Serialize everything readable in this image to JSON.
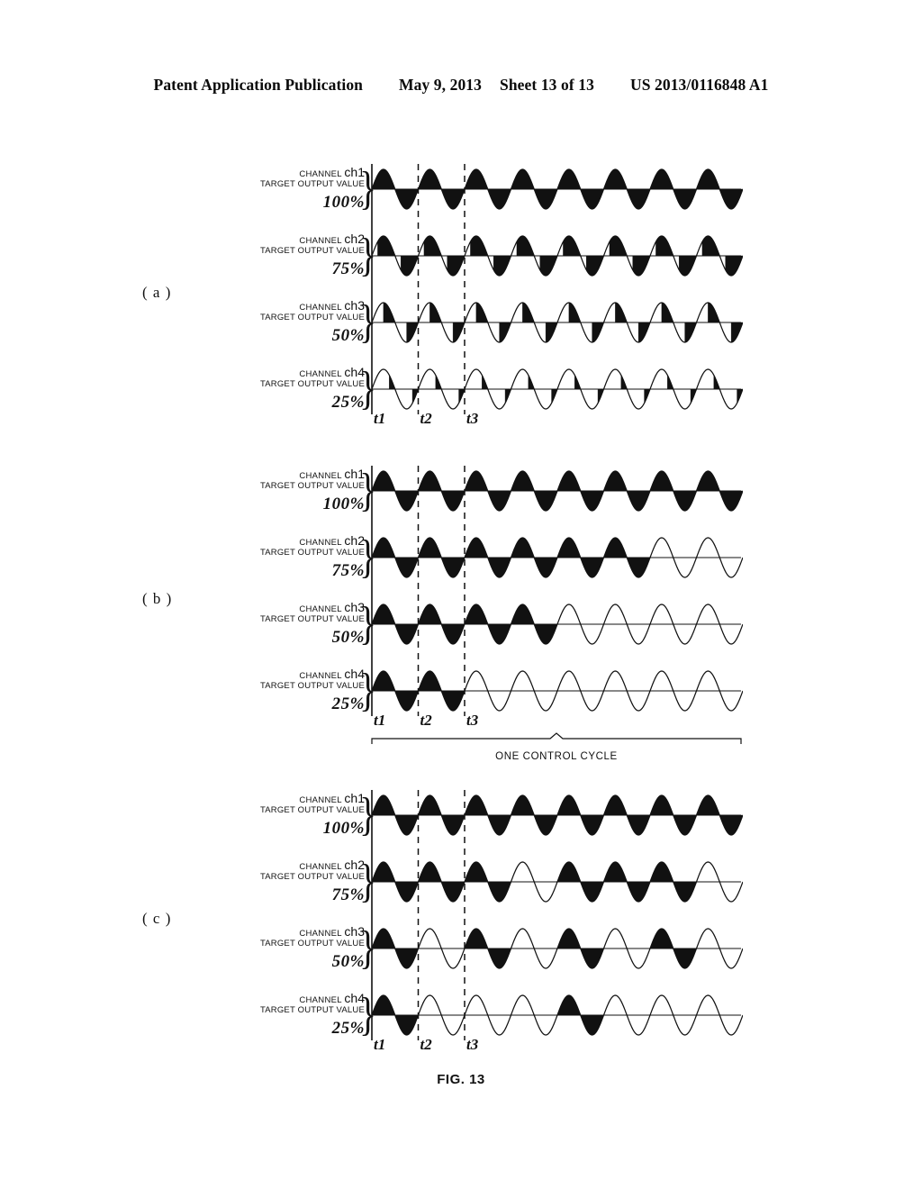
{
  "header": {
    "title": "Patent Application Publication",
    "date": "May 9, 2013",
    "sheet": "Sheet 13 of 13",
    "number": "US 2013/0116848 A1"
  },
  "figure": {
    "caption": "FIG. 13",
    "control_cycle_label": "ONE CONTROL CYCLE",
    "time_markers": [
      "t1",
      "t2",
      "t3"
    ],
    "channel_label_line1_prefix": "CHANNEL",
    "channel_label_line2": "TARGET OUTPUT VALUE",
    "brace_glyph": "}"
  },
  "panels": [
    {
      "letter": "( a )",
      "name": "phase-angle-control",
      "has_control_cycle_bracket": false,
      "channels": [
        {
          "channel": "ch1",
          "percent": "100%",
          "duty": 1.0
        },
        {
          "channel": "ch2",
          "percent": "75%",
          "duty": 0.75
        },
        {
          "channel": "ch3",
          "percent": "50%",
          "duty": 0.5
        },
        {
          "channel": "ch4",
          "percent": "25%",
          "duty": 0.25
        }
      ]
    },
    {
      "letter": "( b )",
      "name": "contiguous-cycle-control",
      "has_control_cycle_bracket": true,
      "channels": [
        {
          "channel": "ch1",
          "percent": "100%",
          "duty": 1.0
        },
        {
          "channel": "ch2",
          "percent": "75%",
          "duty": 0.75
        },
        {
          "channel": "ch3",
          "percent": "50%",
          "duty": 0.5
        },
        {
          "channel": "ch4",
          "percent": "25%",
          "duty": 0.25
        }
      ]
    },
    {
      "letter": "( c )",
      "name": "distributed-cycle-control",
      "has_control_cycle_bracket": false,
      "channels": [
        {
          "channel": "ch1",
          "percent": "100%",
          "duty": 1.0
        },
        {
          "channel": "ch2",
          "percent": "75%",
          "duty": 0.75
        },
        {
          "channel": "ch3",
          "percent": "50%",
          "duty": 0.5
        },
        {
          "channel": "ch4",
          "percent": "25%",
          "duty": 0.25
        }
      ]
    }
  ],
  "chart_data": {
    "type": "line",
    "title": "FIG. 13",
    "xlabel": "",
    "ylabel": "",
    "grid": false,
    "legend": "none",
    "x_annotations": [
      "t1",
      "t2",
      "t3"
    ],
    "span_annotation": "ONE CONTROL CYCLE",
    "cycles_per_trace": 8,
    "panels": [
      {
        "label": "( a )",
        "control_mode": "phase-angle (partial half-cycle conduction)",
        "series": [
          {
            "name": "CHANNEL ch1 TARGET OUTPUT VALUE 100%",
            "duty": 1.0,
            "conduction_fraction_per_half_cycle": 1.0,
            "filled_cycles": [
              1,
              1,
              1,
              1,
              1,
              1,
              1,
              1
            ]
          },
          {
            "name": "CHANNEL ch2 TARGET OUTPUT VALUE 75%",
            "duty": 0.75,
            "conduction_fraction_per_half_cycle": 0.75,
            "filled_cycles": [
              0.75,
              0.75,
              0.75,
              0.75,
              0.75,
              0.75,
              0.75,
              0.75
            ]
          },
          {
            "name": "CHANNEL ch3 TARGET OUTPUT VALUE 50%",
            "duty": 0.5,
            "conduction_fraction_per_half_cycle": 0.5,
            "filled_cycles": [
              0.5,
              0.5,
              0.5,
              0.5,
              0.5,
              0.5,
              0.5,
              0.5
            ]
          },
          {
            "name": "CHANNEL ch4 TARGET OUTPUT VALUE 25%",
            "duty": 0.25,
            "conduction_fraction_per_half_cycle": 0.25,
            "filled_cycles": [
              0.25,
              0.25,
              0.25,
              0.25,
              0.25,
              0.25,
              0.25,
              0.25
            ]
          }
        ]
      },
      {
        "label": "( b )",
        "control_mode": "contiguous whole-cycle burst at start of control cycle",
        "series": [
          {
            "name": "CHANNEL ch1 TARGET OUTPUT VALUE 100%",
            "duty": 1.0,
            "filled_cycles": [
              1,
              1,
              1,
              1,
              1,
              1,
              1,
              1
            ]
          },
          {
            "name": "CHANNEL ch2 TARGET OUTPUT VALUE 75%",
            "duty": 0.75,
            "filled_cycles": [
              1,
              1,
              1,
              1,
              1,
              1,
              0,
              0
            ]
          },
          {
            "name": "CHANNEL ch3 TARGET OUTPUT VALUE 50%",
            "duty": 0.5,
            "filled_cycles": [
              1,
              1,
              1,
              1,
              0,
              0,
              0,
              0
            ]
          },
          {
            "name": "CHANNEL ch4 TARGET OUTPUT VALUE 25%",
            "duty": 0.25,
            "filled_cycles": [
              1,
              1,
              0,
              0,
              0,
              0,
              0,
              0
            ]
          }
        ]
      },
      {
        "label": "( c )",
        "control_mode": "distributed whole-cycle conduction across control cycle",
        "series": [
          {
            "name": "CHANNEL ch1 TARGET OUTPUT VALUE 100%",
            "duty": 1.0,
            "filled_cycles": [
              1,
              1,
              1,
              1,
              1,
              1,
              1,
              1
            ]
          },
          {
            "name": "CHANNEL ch2 TARGET OUTPUT VALUE 75%",
            "duty": 0.75,
            "filled_cycles": [
              1,
              1,
              1,
              0,
              1,
              1,
              1,
              0
            ]
          },
          {
            "name": "CHANNEL ch3 TARGET OUTPUT VALUE 50%",
            "duty": 0.5,
            "filled_cycles": [
              1,
              0,
              1,
              0,
              1,
              0,
              1,
              0
            ]
          },
          {
            "name": "CHANNEL ch4 TARGET OUTPUT VALUE 25%",
            "duty": 0.25,
            "filled_cycles": [
              1,
              0,
              0,
              0,
              1,
              0,
              0,
              0
            ]
          }
        ]
      }
    ]
  }
}
